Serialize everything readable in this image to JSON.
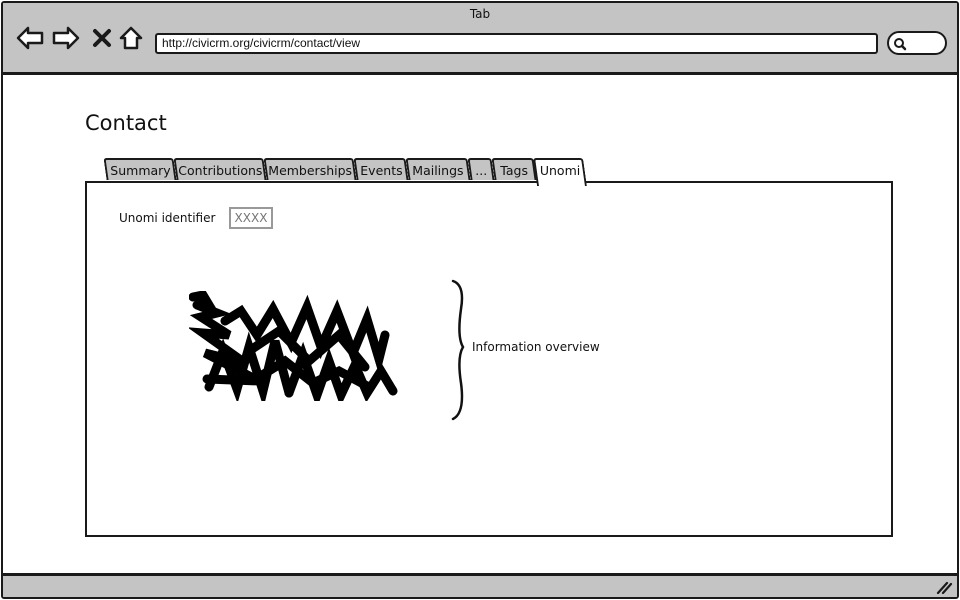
{
  "browser": {
    "tab_title": "Tab",
    "url": "http://civicrm.org/civicrm/contact/view",
    "icons": [
      "back-arrow-icon",
      "forward-arrow-icon",
      "close-icon",
      "home-icon",
      "search-icon",
      "resize-grip-icon"
    ]
  },
  "page": {
    "title": "Contact"
  },
  "tabs": [
    {
      "label": "Summary"
    },
    {
      "label": "Contributions"
    },
    {
      "label": "Memberships"
    },
    {
      "label": "Events"
    },
    {
      "label": "Mailings"
    },
    {
      "label": "..."
    },
    {
      "label": "Tags"
    },
    {
      "label": "Unomi",
      "active": true
    }
  ],
  "unomi": {
    "identifier_label": "Unomi identifier",
    "identifier_value": "XXXX",
    "overview_label": "Information overview"
  },
  "colors": {
    "chrome": "#c4c4c4",
    "ink": "#1a1a1a",
    "placeholder": "#999999"
  }
}
